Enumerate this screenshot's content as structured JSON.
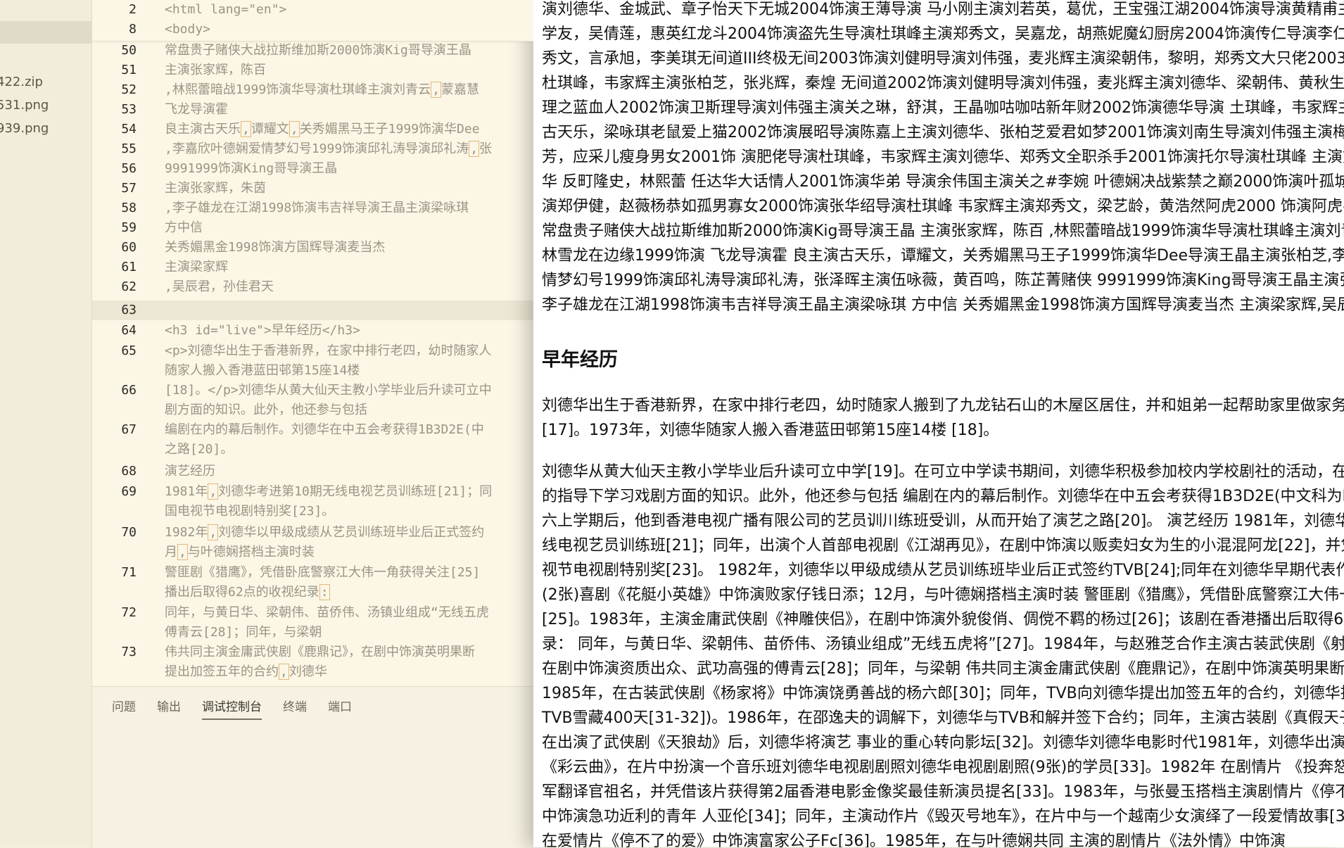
{
  "sidebar": {
    "files": [
      "422.zip",
      "531.png",
      "939.png"
    ]
  },
  "editor": {
    "sticky": [
      {
        "ln": "2",
        "text": "<html lang=\"en\">"
      },
      {
        "ln": "8",
        "text": "<body>"
      }
    ],
    "lines": [
      {
        "ln": "50",
        "text": "常盘贵子赌侠大战拉斯维加斯2000饰演Kig哥导演王晶"
      },
      {
        "ln": "51",
        "text": "主演张家辉，陈百"
      },
      {
        "ln": "52",
        "pre": ",林熙蕾暗战1999饰演华导演杜琪峰主演刘青云",
        "mark": ",",
        "post": "蒙嘉慧"
      },
      {
        "ln": "53",
        "text": "飞龙导演霍"
      },
      {
        "ln": "54",
        "pre": "良主演古天乐",
        "mark": ",",
        "mid": "谭耀文",
        "mark2": ",",
        "post": "关秀媚黑马王子1999饰演华Dee"
      },
      {
        "ln": "55",
        "pre": ",李嘉欣叶德娴爱情梦幻号1999饰演邱礼涛导演邱礼涛",
        "mark": ",",
        "post": "张"
      },
      {
        "ln": "56",
        "text": "9991999饰演King哥导演王晶"
      },
      {
        "ln": "57",
        "text": "主演张家辉，朱茵"
      },
      {
        "ln": "58",
        "text": ",李子雄龙在江湖1998饰演韦吉祥导演王晶主演梁咏琪"
      },
      {
        "ln": "59",
        "text": "方中信"
      },
      {
        "ln": "60",
        "text": "关秀媚黑金1998饰演方国辉导演麦当杰"
      },
      {
        "ln": "61",
        "text": "主演梁家辉"
      },
      {
        "ln": "62",
        "text": ",吴辰君，孙佳君天"
      },
      {
        "ln": "63",
        "text": ""
      },
      {
        "ln": "64",
        "text": "<h3 id=\"live\">早年经历</h3>"
      },
      {
        "ln": "65",
        "text": "<p>刘德华出生于香港新界，在家中排行老四，幼时随家人",
        "cont": "随家人搬入香港蓝田邨第15座14楼"
      },
      {
        "ln": "66",
        "text": "[18]。</p>刘德华从黄大仙天主教小学毕业后升读可立中",
        "cont": "剧方面的知识。此外，他还参与包括"
      },
      {
        "ln": "67",
        "text": "编剧在内的幕后制作。刘德华在中五会考获得1B3D2E(中",
        "cont": "之路[20]。"
      },
      {
        "ln": "68",
        "text": "演艺经历"
      },
      {
        "ln": "69",
        "pre": "1981年",
        "mark": ",",
        "post": "刘德华考进第10期无线电视艺员训练班[21]；同",
        "cont": "国电视节电视剧特别奖[23]。"
      },
      {
        "ln": "70",
        "pre": "1982年",
        "mark": ",",
        "post": "刘德华以甲级成绩从艺员训练班毕业后正式签约",
        "cont_pre": "月",
        "cont_mark": ",",
        "cont_post": "与叶德娴搭档主演时装"
      },
      {
        "ln": "71",
        "text": "警匪剧《猎鹰》，凭借卧底警察江大伟一角获得关注[25]",
        "cont_pre": "播出后取得62点的收视纪录",
        "cont_mark": ":"
      },
      {
        "ln": "72",
        "text": "同年，与黄日华、梁朝伟、苗侨伟、汤镇业组成“无线五虎",
        "cont": "傅青云[28]；同年，与梁朝"
      },
      {
        "ln": "73",
        "text": "伟共同主演金庸武侠剧《鹿鼎记》，在剧中饰演英明果断",
        "cont_pre": "提出加签五年的合约",
        "cont_mark": ",",
        "cont_post": "刘德华"
      }
    ]
  },
  "panel": {
    "tabs": [
      "问题",
      "输出",
      "调试控制台",
      "终端",
      "端口"
    ],
    "active_tab": "调试控制台"
  },
  "preview": {
    "top_lines": [
      "演刘德华、金城武、章子怡天下无城2004饰演王薄导演 马小刚主演刘若英，葛优，王宝强江湖2004饰演导演黄精甫主演刘德华、张学友，",
      "学友，吴倩莲，惠英红龙斗2004饰演盗先生导演杜琪峰主演郑秀文，吴嘉龙，胡燕妮魔幻厨房2004饰演传仁导演李仁港主演李心洁",
      "秀文，言承旭，李美琪无间道III终极无间2003饰演刘健明导演刘伟强，麦兆辉主演梁朝伟，黎明，郑秀文大只佬2003饰演大只佬导演",
      "杜琪峰，韦家辉主演张柏芝，张兆辉，秦煌 无间道2002饰演刘健明导演刘伟强，麦兆辉主演刘德华、梁朝伟、黄秋生、曾志伟、陈慧琳",
      "理之蓝血人2002饰演卫斯理导演刘伟强主演关之琳，舒淇，王晶咖咕咖咕新年财2002饰演德华导演 土琪峰，韦家辉主演刘德华、",
      "古天乐，梁咏琪老鼠爱上猫2002饰演展昭导演陈嘉上主演刘德华、张柏芝爱君如梦2001饰演刘南生导演刘伟强主演梅艳芳、吴君如、",
      "芳，应采儿瘦身男女2001饰 演肥佬导演杜琪峰，韦家辉主演刘德华、郑秀文全职杀手2001饰演托尔导演杜琪峰 主演刘德华、反町隆史",
      "华 反町隆史，林熙蕾 任达华大话情人2001饰演华弟 导演余伟国主演关之#李婉 叶德娴决战紫禁之巅2000饰演叶孤城导演刘伟强",
      "演郑伊健，赵薇杨恭如孤男寡女2000饰演张华绍导演杜琪峰 韦家辉主演郑秀文，梁艺龄，黄浩然阿虎2000 饰演阿虎导演刘德华",
      "常盘贵子赌侠大战拉斯维加斯2000饰演Kig哥导演王晶 主演张家辉，陈百 ,林熙蕾暗战1999饰演华导演杜琪峰主演刘青云,蒙嘉慧",
      "林雪龙在边缘1999饰演 飞龙导演霍 良主演古天乐，谭耀文，关秀媚黑马王子1999饰演华Dee导演王晶主演张柏芝,李嘉欣叶德娴爱",
      "情梦幻号1999饰演邱礼涛导演邱礼涛，张泽晖主演伍咏薇，黄百鸣，陈芷菁赌侠 9991999饰演King哥导演王晶主演张家辉，朱茵,",
      "李子雄龙在江湖1998饰演韦吉祥导演王晶主演梁咏琪 方中信 关秀媚黑金1998饰演方国辉导演麦当杰 主演梁家辉,吴辰君，孙佳君"
    ],
    "heading": "早年经历",
    "para1": [
      "刘德华出生于香港新界，在家中排行老四，幼时随家人搬到了九龙钻石山的木屋区居住，并和姐弟一起帮助家里做家务",
      "[17]。1973年，刘德华随家人搬入香港蓝田邨第15座14楼 [18]。"
    ],
    "para2": [
      "刘德华从黄大仙天主教小学毕业后升读可立中学[19]。在可立中学读书期间，刘德华积极参加校内学校剧社的活动，在老师",
      "的指导下学习戏剧方面的知识。此外，他还参与包括 编剧在内的幕后制作。刘德华在中五会考获得1B3D2E(中文科为B)成绩，中",
      "六上学期后，他到香港电视广播有限公司的艺员训川练班受训，从而开始了演艺之路[20]。 演艺经历 1981年，刘德华考进第10期无",
      "线电视艺员训练班[21]；同年，出演个人首部电视剧《江湖再见》，在剧中饰演以贩卖妇女为生的小混混阿龙[22]，并凭该剧获得中国电",
      "视节电视剧特别奖[23]。 1982年，刘德华以甲级成绩从艺员训练班毕业后正式签约TVB[24];同年在刘德华早期代表作之一的电视剧",
      "(2张)喜剧《花艇小英雄》中饰演败家仔钱日添；12月，与叶德娴搭档主演时装 警匪剧《猎鹰》，凭借卧底警察江大伟一角获得关注",
      "[25]。1983年，主演金庸武侠剧《神雕侠侣》，在剧中饰演外貌俊俏、倜傥不羁的杨过[26]；该剧在香港播出后取得62点的收视纪",
      "录： 同年，与黄日华、梁朝伟、苗侨伟、汤镇业组成”无线五虎将”[27]。1984年，与赵雅芝合作主演古装武侠剧《射雕英雄传》，",
      "在剧中饰演资质出众、武功高强的傅青云[28]；同年，与梁朝 伟共同主演金庸武侠剧《鹿鼎记》，在剧中饰演英明果断的康熙帝[29]。",
      "1985年，在古装武侠剧《杨家将》中饰演饶勇善战的杨六郎[30]；同年，TVB向刘德华提出加签五年的合约，刘德华拒绝后被",
      "TVB雪藏400天[31-32])。1986年，在邵逸夫的调解下，刘德华与TVB和解并签下合约；同年，主演古装剧《真假天子》。 1987年",
      "在出演了武侠剧《天狼劫》后，刘德华将演艺 事业的重心转向影坛[32]。刘德华刘德华电影时代1981年，刘德华出演个人首部电影",
      "《彩云曲》，在片中扮演一个音乐班刘德华电视剧剧照刘德华电视剧剧照(9张)的学员[33]。1982年 在剧情片 《投奔怒海》中饰演",
      "军翻译官祖名，并凭借该片获得第2届香港电影金像奖最佳新演员提名[33]。1983年，与张曼玉搭档主演剧情片《停不了的爱》，在片",
      "中饰演急功近利的青年 人亚伦[34]；同年，主演动作片《毁灭号地车》，在片中与一个越南少女演绎了一段爱情故事[35]。1984年",
      "在爱情片《停不了的爱》中饰演富家公子Fc[36]。1985年，在与叶德娴共同 主演的剧情片《法外情》中饰演"
    ]
  }
}
